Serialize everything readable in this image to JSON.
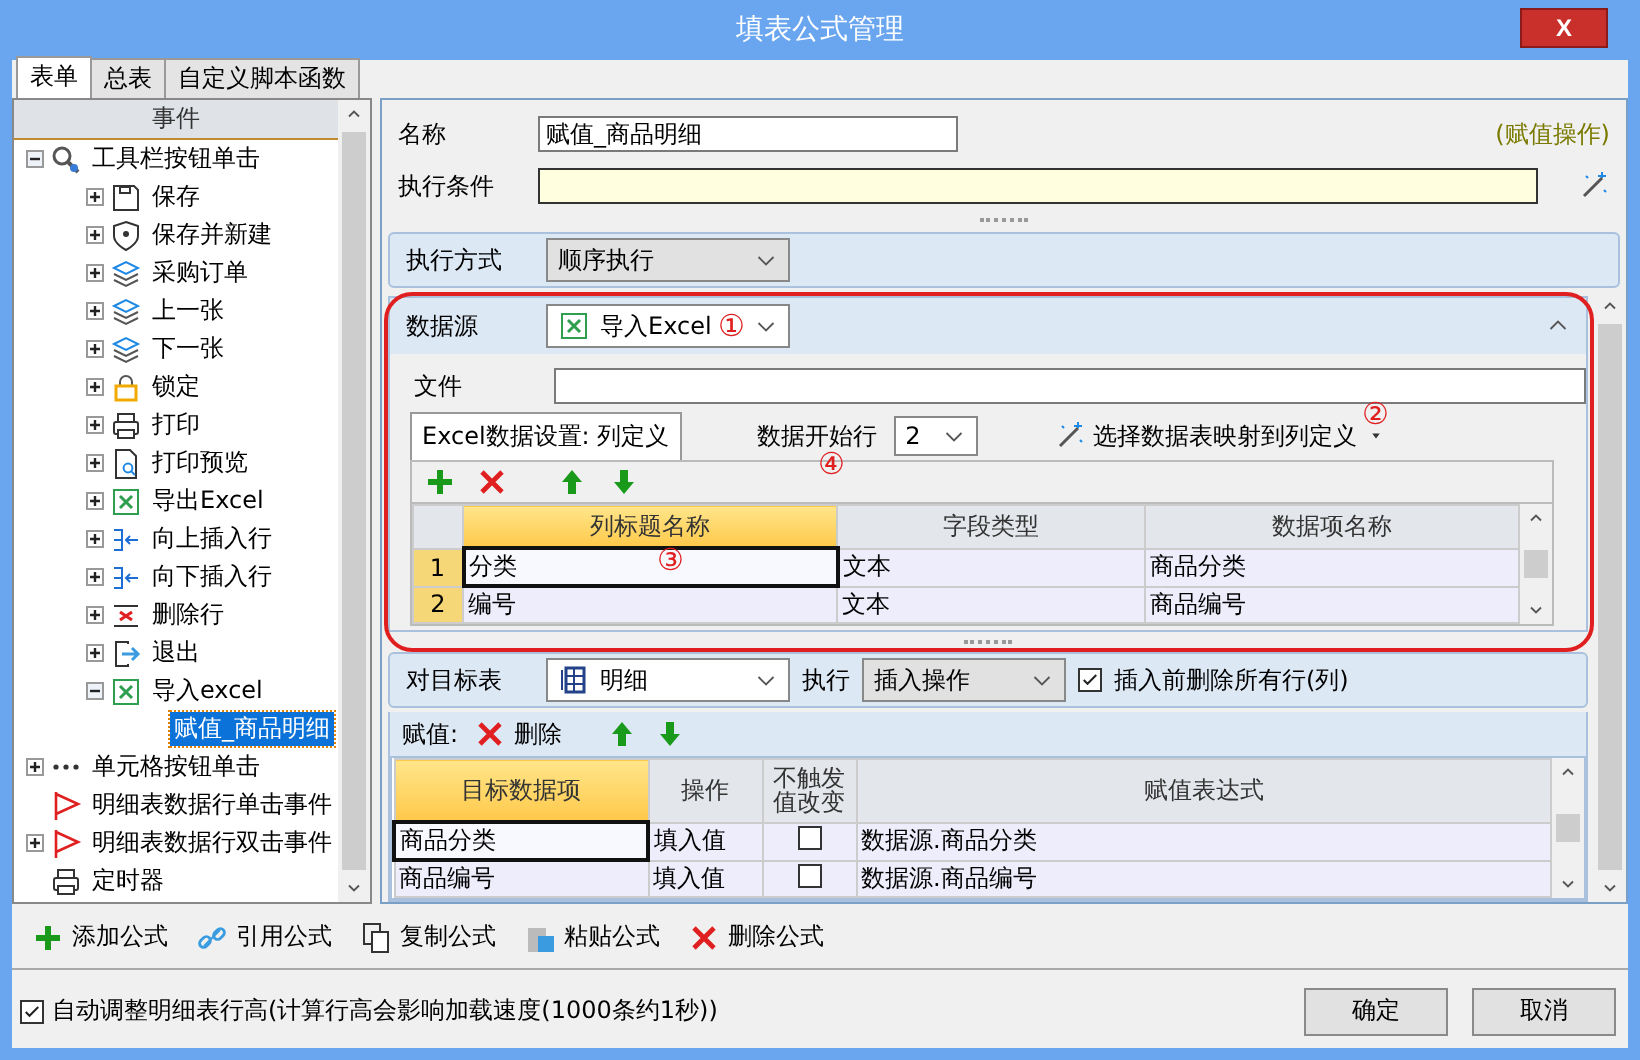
{
  "window": {
    "title": "填表公式管理",
    "close": "X"
  },
  "tabs": [
    {
      "label": "表单",
      "selected": true
    },
    {
      "label": "总表",
      "selected": false
    },
    {
      "label": "自定义脚本函数",
      "selected": false
    }
  ],
  "tree": {
    "header": "事件",
    "items": [
      {
        "label": "工具栏按钮单击",
        "kind": "tool",
        "expandable": true,
        "expanded": true,
        "selected": false,
        "children": [
          {
            "label": "保存",
            "kind": "save",
            "expandable": true,
            "expanded": false,
            "selected": false
          },
          {
            "label": "保存并新建",
            "kind": "shield",
            "expandable": true,
            "expanded": false,
            "selected": false
          },
          {
            "label": "采购订单",
            "kind": "layers",
            "expandable": true,
            "expanded": false,
            "selected": false
          },
          {
            "label": "上一张",
            "kind": "layers",
            "expandable": true,
            "expanded": false,
            "selected": false
          },
          {
            "label": "下一张",
            "kind": "layers",
            "expandable": true,
            "expanded": false,
            "selected": false
          },
          {
            "label": "锁定",
            "kind": "lock",
            "expandable": true,
            "expanded": false,
            "selected": false
          },
          {
            "label": "打印",
            "kind": "printer",
            "expandable": true,
            "expanded": false,
            "selected": false
          },
          {
            "label": "打印预览",
            "kind": "preview",
            "expandable": true,
            "expanded": false,
            "selected": false
          },
          {
            "label": "导出Excel",
            "kind": "excel",
            "expandable": true,
            "expanded": false,
            "selected": false
          },
          {
            "label": "向上插入行",
            "kind": "insert",
            "expandable": true,
            "expanded": false,
            "selected": false
          },
          {
            "label": "向下插入行",
            "kind": "insert",
            "expandable": true,
            "expanded": false,
            "selected": false
          },
          {
            "label": "删除行",
            "kind": "delete",
            "expandable": true,
            "expanded": false,
            "selected": false
          },
          {
            "label": "退出",
            "kind": "exit",
            "expandable": true,
            "expanded": false,
            "selected": false
          },
          {
            "label": "导入excel",
            "kind": "excel",
            "expandable": true,
            "expanded": true,
            "selected": false,
            "children": [
              {
                "label": "赋值_商品明细",
                "expandable": false,
                "selected": true
              }
            ]
          }
        ]
      },
      {
        "label": "单元格按钮单击",
        "kind": "dots",
        "expandable": true,
        "expanded": false,
        "selected": false
      },
      {
        "label": "明细表数据行单击事件",
        "kind": "flag",
        "expandable": false,
        "selected": false
      },
      {
        "label": "明细表数据行双击事件",
        "kind": "flag",
        "expandable": true,
        "expanded": false,
        "selected": false
      },
      {
        "label": "定时器",
        "kind": "printer",
        "expandable": false,
        "selected": false
      }
    ]
  },
  "name": {
    "label": "名称",
    "value": "赋值_商品明细",
    "type": "(赋值操作)"
  },
  "condition": {
    "label": "执行条件"
  },
  "execution": {
    "label": "执行方式",
    "value": "顺序执行"
  },
  "datasource": {
    "label": "数据源",
    "value": "导入Excel",
    "annotation": "①",
    "file_label": "文件",
    "tab": "Excel数据设置: 列定义",
    "start_row_label": "数据开始行",
    "start_row": "2",
    "start_annotation": "④",
    "mapping": "选择数据表映射到列定义",
    "mapping_annotation": "②",
    "columns": [
      {
        "label": "列标题名称",
        "selected": true
      },
      {
        "label": "字段类型",
        "selected": false
      },
      {
        "label": "数据项名称",
        "selected": false
      }
    ],
    "rows": [
      {
        "number": "1",
        "cells": [
          "分类",
          "文本",
          "商品分类"
        ],
        "selected": true,
        "annotation": "③"
      },
      {
        "number": "2",
        "cells": [
          "编号",
          "文本",
          "商品编号"
        ],
        "selected": false
      }
    ]
  },
  "target": {
    "label": "对目标表",
    "table": "明细",
    "exec_label": "执行",
    "exec": "插入操作",
    "clear": {
      "label": "插入前删除所有行(列)",
      "checked": true
    }
  },
  "assign": {
    "label": "赋值:",
    "delete": "删除",
    "columns": [
      {
        "label": "目标数据项",
        "selected": true
      },
      {
        "label": "操作",
        "selected": false
      },
      {
        "label": "不触发值改变",
        "selected": false
      },
      {
        "label": "赋值表达式",
        "selected": false
      }
    ],
    "rows": [
      {
        "target": "商品分类",
        "operation": "填入值",
        "no_trigger": false,
        "expression": "数据源.商品分类",
        "selected": true
      },
      {
        "target": "商品编号",
        "operation": "填入值",
        "no_trigger": false,
        "expression": "数据源.商品编号",
        "selected": false
      }
    ]
  },
  "toolbar": [
    {
      "label": "添加公式",
      "kind": "add"
    },
    {
      "label": "引用公式",
      "kind": "link"
    },
    {
      "label": "复制公式",
      "kind": "copy"
    },
    {
      "label": "粘贴公式",
      "kind": "paste"
    },
    {
      "label": "删除公式",
      "kind": "delete"
    }
  ],
  "auto_height": {
    "label": "自动调整明细表行高(计算行高会影响加载速度(1000条约1秒))",
    "checked": true
  },
  "buttons": [
    "确定",
    "取消"
  ]
}
